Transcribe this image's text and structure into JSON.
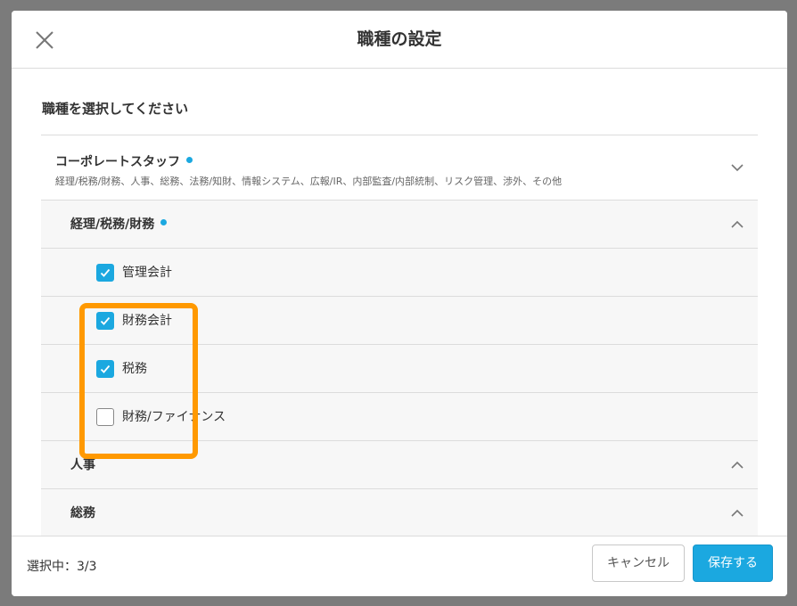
{
  "header": {
    "title": "職種の設定",
    "close_icon": "close-icon"
  },
  "body": {
    "prompt": "職種を選択してください",
    "category": {
      "name": "コーポレートスタッフ",
      "description": "経理/税務/財務、人事、総務、法務/知財、情報システム、広報/IR、内部監査/内部統制、リスク管理、渉外、その他",
      "expanded": false
    },
    "subcategories": [
      {
        "name": "経理/税務/財務",
        "has_selection": true,
        "expanded": true,
        "items": [
          {
            "label": "管理会計",
            "checked": true
          },
          {
            "label": "財務会計",
            "checked": true
          },
          {
            "label": "税務",
            "checked": true
          },
          {
            "label": "財務/ファイナンス",
            "checked": false
          }
        ]
      },
      {
        "name": "人事",
        "has_selection": false
      },
      {
        "name": "総務",
        "has_selection": false
      }
    ]
  },
  "footer": {
    "selection_count": "選択中：3/3",
    "cancel_label": "キャンセル",
    "save_label": "保存する"
  },
  "colors": {
    "accent": "#1ba8e0",
    "highlight": "#ff9900",
    "backdrop": "#7b7b7b"
  }
}
